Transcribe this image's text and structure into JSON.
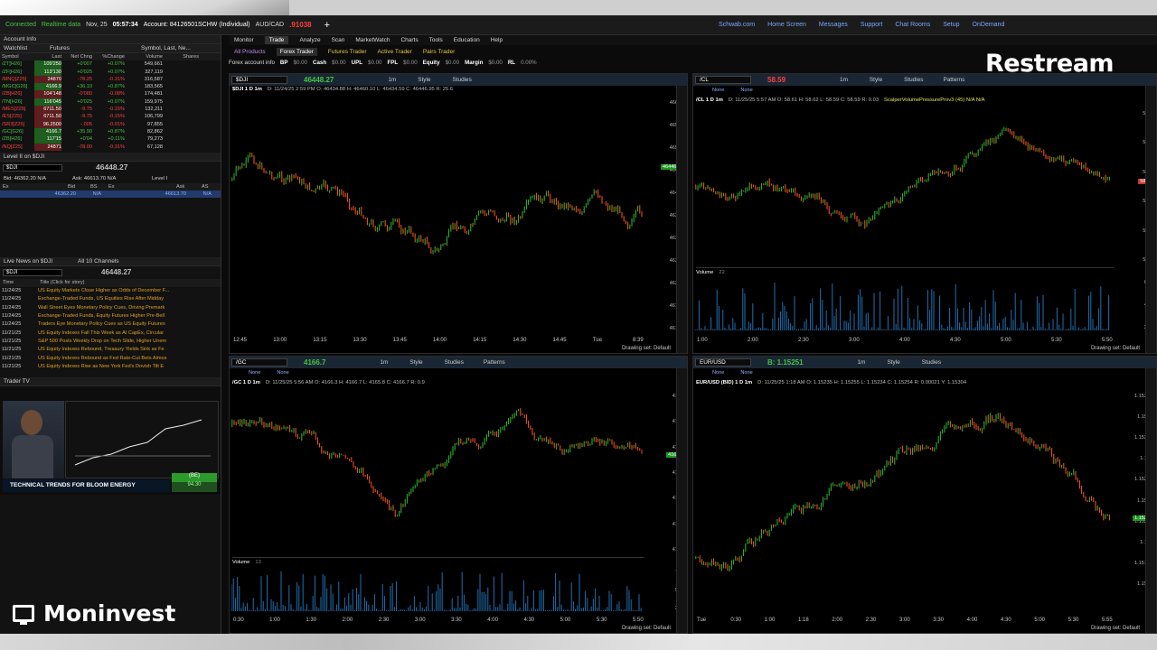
{
  "status": {
    "connected": "Connected",
    "realtime": "Realtime data",
    "date": "Nov, 25",
    "time": "05:57:34",
    "account": "Account: 84126501SCHW (Individual)",
    "pair": "AUD/CAD",
    "pair_price": ".91038",
    "right_items": [
      "Schwab.com",
      "Home Screen",
      "Messages",
      "Support",
      "Chat Rooms",
      "Setup",
      "OnDemand"
    ]
  },
  "left": {
    "account_info": "Account Info",
    "watchlist_label": "Watchlist",
    "watchlist_name": "Futures",
    "watchlist_sort": "Symbol, Last, Ne...",
    "columns": [
      "Symbol",
      "Last",
      "Net Chng",
      "%Change",
      "Volume",
      "Shares"
    ],
    "rows": [
      {
        "sym": "/ZT[H26]",
        "last": "109'250",
        "chg": "+0'007",
        "pct": "+0.07%",
        "vol": "549,661"
      },
      {
        "sym": "/ZF[H26]",
        "last": "113'130",
        "chg": "+0'025",
        "pct": "+0.07%",
        "vol": "327,119"
      },
      {
        "sym": "/MNQ[Z25]",
        "last": "24870",
        "chg": "-78.25",
        "pct": "-0.31%",
        "vol": "316,587"
      },
      {
        "sym": "/MGC[G26]",
        "last": "4166.9",
        "chg": "+36.10",
        "pct": "+0.87%",
        "vol": "183,565"
      },
      {
        "sym": "/ZB[H26]",
        "last": "104'148",
        "chg": "-0'080",
        "pct": "-0.08%",
        "vol": "174,481"
      },
      {
        "sym": "/TN[H26]",
        "last": "116'045",
        "chg": "+0'025",
        "pct": "+0.07%",
        "vol": "159,975"
      },
      {
        "sym": "/MES[Z25]",
        "last": "6711.50",
        "chg": "-9.75",
        "pct": "-0.15%",
        "vol": "132,211"
      },
      {
        "sym": "/ES[Z25]",
        "last": "6711.50",
        "chg": "-9.75",
        "pct": "-0.15%",
        "vol": "106,799"
      },
      {
        "sym": "/SR3[Z25]",
        "last": "96.2500",
        "chg": "-.005",
        "pct": "-0.01%",
        "vol": "97,855"
      },
      {
        "sym": "/GC[G26]",
        "last": "4166.7",
        "chg": "+35.90",
        "pct": "+0.87%",
        "vol": "82,862"
      },
      {
        "sym": "/ZB[H26]",
        "last": "117'15",
        "chg": "+0'04",
        "pct": "+0.11%",
        "vol": "79,273"
      },
      {
        "sym": "/NQ[Z25]",
        "last": "24871",
        "chg": "-78.00",
        "pct": "-0.31%",
        "vol": "67,128"
      }
    ],
    "level2_label": "Level II on $DJI",
    "level2_symbol": "$DJI",
    "level2_price": "46448.27",
    "bid_text": "Bid: 46362.20 N/A",
    "ask_text": "Ask: 46613.70 N/A",
    "level_label": "Level I",
    "l2_cols": [
      "Ex",
      "Bid",
      "BS",
      "Ex",
      "Ask",
      "AS"
    ],
    "l2_bid": "46362.20",
    "l2_bid_na": "N/A",
    "l2_ask": "46613.70",
    "l2_ask_na": "N/A",
    "news_label": "Live News on $DJI",
    "news_channels": "All 10 Channels",
    "news_symbol": "$DJI",
    "news_price": "46448.27",
    "news_cols": [
      "Time",
      "Title (Click for story)"
    ],
    "news": [
      {
        "time": "11/24/25",
        "title": "US Equity Markets Close Higher as Odds of December F..."
      },
      {
        "time": "11/24/25",
        "title": "Exchange-Traded Funds, US Equities Rise After Midday"
      },
      {
        "time": "11/24/25",
        "title": "Wall Street Eyes Monetary Policy Cues, Driving Premark"
      },
      {
        "time": "11/24/25",
        "title": "Exchange-Traded Funds, Equity Futures Higher Pre-Bell"
      },
      {
        "time": "11/24/25",
        "title": "Traders Eye Monetary Policy Cues as US Equity Futures"
      },
      {
        "time": "11/21/25",
        "title": "US Equity Indexes Fall This Week as AI CapEx, Circular"
      },
      {
        "time": "11/21/25",
        "title": "S&P 500 Posts Weekly Drop on Tech Slide, Higher Unem"
      },
      {
        "time": "11/21/25",
        "title": "US Equity Indexes Rebound, Treasury Yields Sink as Fe"
      },
      {
        "time": "11/21/25",
        "title": "US Equity Indexes Rebound as Fed Rate-Cut Bets Almos"
      },
      {
        "time": "11/21/25",
        "title": "US Equity Indexes Rise as New York Fed's Dovish Tilt E"
      }
    ],
    "trader_tv": "Trader TV",
    "tv_caption": "TECHNICAL TRENDS FOR BLOOM ENERGY",
    "tv_badge": "(BE)",
    "tv_price": "94.30"
  },
  "menu": [
    "Monitor",
    "Trade",
    "Analyze",
    "Scan",
    "MarketWatch",
    "Charts",
    "Tools",
    "Education",
    "Help"
  ],
  "menu_active": "Trade",
  "subtabs": [
    "All Products",
    "Forex Trader",
    "Futures Trader",
    "Active Trader",
    "Pairs Trader"
  ],
  "acct_bar": [
    "Forex account info",
    "BP",
    "$0.00",
    "Cash",
    "$0.00",
    "UPL",
    "$0.00",
    "FPL",
    "$0.00",
    "Equity",
    "$0.00",
    "Margin",
    "$0.00",
    "RL",
    "0.00%"
  ],
  "drawing_set": "Drawing set: Default",
  "charts": {
    "dji": {
      "symbol": "$DJI",
      "price": "46448.27",
      "title": "$DJI 1 D 1m",
      "info": "D: 11/24/25 2:59 PM  O: 46434.88  H: 46460.10  L: 46434.59  C: 46446.95  R: 25.6",
      "yticks": [
        "46600",
        "46550",
        "46500",
        "46450",
        "46400",
        "46350",
        "46300",
        "46250",
        "46200",
        "46150",
        "46100"
      ],
      "xticks": [
        "12:45",
        "13:00",
        "13:15",
        "13:30",
        "13:45",
        "14:00",
        "14:15",
        "14:30",
        "14:45",
        "Tue",
        "8:39"
      ],
      "last_tag": "46446.95"
    },
    "cl": {
      "symbol": "/CL",
      "price": "58.59",
      "title": "/CL 1 D 1m",
      "info": "D: 11/25/25 5:57 AM  O: 58.61  H: 58.62  L: 58.59  C: 58.59  R: 0.03",
      "study": "ScalperVolumePressureProv3 (45)  N/A  N/A",
      "yticks": [
        "58.8",
        "58.7",
        "58.6",
        "58.5",
        "58.4",
        "58.3"
      ],
      "vol_label": "Volume",
      "vol_value": "22",
      "vol_ticks": [
        "600",
        "400",
        "200"
      ],
      "xticks": [
        "1:00",
        "2:00",
        "2:30",
        "3:00",
        "4:00",
        "4:30",
        "5:00",
        "5:30",
        "5:50"
      ],
      "last_tag": "58.59"
    },
    "gc": {
      "symbol": "/GC",
      "price": "4166.7",
      "title": "/GC 1 D 1m",
      "info": "D: 11/25/25 5:56 AM  O: 4166.3  H: 4166.7  L: 4165.8  C: 4166.7  R: 0.9",
      "yticks": [
        "4175",
        "4170",
        "4165",
        "4160",
        "4155",
        "4150",
        "4145"
      ],
      "vol_label": "Volume",
      "vol_value": "13",
      "vol_ticks": [
        "750",
        "500",
        "250"
      ],
      "xticks": [
        "0:30",
        "1:00",
        "1:30",
        "2:00",
        "2:30",
        "3:00",
        "3:30",
        "4:00",
        "4:30",
        "5:00",
        "5:30",
        "5:50"
      ],
      "last_tag": "4166.7"
    },
    "eur": {
      "symbol": "EUR/USD",
      "price": "B: 1.15251",
      "title": "EUR/USD (BID) 1 D 1m",
      "info": "D: 11/25/25 1:18 AM  O: 1.15235  H: 1.15255  L: 1.15234  C: 1.15254  R: 0.00021  Y: 1.15304",
      "yticks": [
        "1.15304",
        "1.1535",
        "1.15325",
        "1.153",
        "1.15275",
        "1.1525",
        "1.15225",
        "1.152",
        "1.15175",
        "1.1515"
      ],
      "xticks": [
        "Tue",
        "0:30",
        "1:00",
        "1:18",
        "2:00",
        "2:30",
        "3:00",
        "3:30",
        "4:00",
        "4:30",
        "5:00",
        "5:30",
        "5:55"
      ],
      "last_tag": "1.15251"
    }
  },
  "labels": {
    "studies": "Studies",
    "style": "Style",
    "patterns": "Patterns",
    "interval": "1m",
    "none": "None"
  },
  "overlay": {
    "restream": "Restream",
    "moninvest": "Moninvest"
  }
}
